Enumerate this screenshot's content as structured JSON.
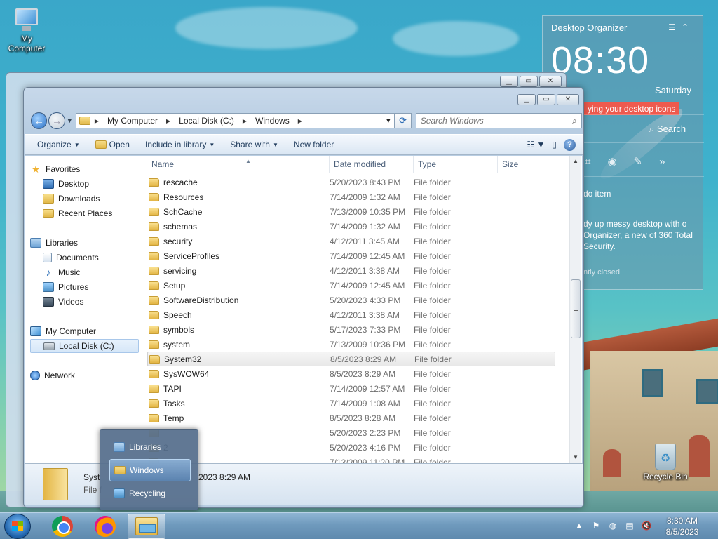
{
  "desktop": {
    "icons": [
      {
        "label": "My Computer"
      },
      {
        "label": "Recycle Bin"
      }
    ]
  },
  "organizer": {
    "title": "Desktop Organizer",
    "time": "08:30",
    "date_partial": "23",
    "weekday": "Saturday",
    "banner": "ying your desktop icons",
    "search_label": "Search",
    "todo": "do item",
    "description": "dy up messy desktop with o Organizer, a new of 360 Total Security.",
    "closed": "ntly closed"
  },
  "window": {
    "address": {
      "segments": [
        "My Computer",
        "Local Disk (C:)",
        "Windows"
      ]
    },
    "search": {
      "placeholder": "Search Windows"
    },
    "toolbar": {
      "organize": "Organize",
      "open": "Open",
      "include": "Include in library",
      "share": "Share with",
      "new_folder": "New folder"
    },
    "nav": {
      "favorites": "Favorites",
      "desktop": "Desktop",
      "downloads": "Downloads",
      "recent": "Recent Places",
      "libraries": "Libraries",
      "documents": "Documents",
      "music": "Music",
      "pictures": "Pictures",
      "videos": "Videos",
      "my_computer": "My Computer",
      "local_disk": "Local Disk (C:)",
      "network": "Network"
    },
    "columns": {
      "name": "Name",
      "date": "Date modified",
      "type": "Type",
      "size": "Size"
    },
    "files": [
      {
        "name": "rescache",
        "date": "5/20/2023 8:43 PM",
        "type": "File folder"
      },
      {
        "name": "Resources",
        "date": "7/14/2009 1:32 AM",
        "type": "File folder"
      },
      {
        "name": "SchCache",
        "date": "7/13/2009 10:35 PM",
        "type": "File folder"
      },
      {
        "name": "schemas",
        "date": "7/14/2009 1:32 AM",
        "type": "File folder"
      },
      {
        "name": "security",
        "date": "4/12/2011 3:45 AM",
        "type": "File folder"
      },
      {
        "name": "ServiceProfiles",
        "date": "7/14/2009 12:45 AM",
        "type": "File folder"
      },
      {
        "name": "servicing",
        "date": "4/12/2011 3:38 AM",
        "type": "File folder"
      },
      {
        "name": "Setup",
        "date": "7/14/2009 12:45 AM",
        "type": "File folder"
      },
      {
        "name": "SoftwareDistribution",
        "date": "5/20/2023 4:33 PM",
        "type": "File folder"
      },
      {
        "name": "Speech",
        "date": "4/12/2011 3:38 AM",
        "type": "File folder"
      },
      {
        "name": "symbols",
        "date": "5/17/2023 7:33 PM",
        "type": "File folder"
      },
      {
        "name": "system",
        "date": "7/13/2009 10:36 PM",
        "type": "File folder"
      },
      {
        "name": "System32",
        "date": "8/5/2023 8:29 AM",
        "type": "File folder"
      },
      {
        "name": "SysWOW64",
        "date": "8/5/2023 8:29 AM",
        "type": "File folder"
      },
      {
        "name": "TAPI",
        "date": "7/14/2009 12:57 AM",
        "type": "File folder"
      },
      {
        "name": "Tasks",
        "date": "7/14/2009 1:08 AM",
        "type": "File folder"
      },
      {
        "name": "Temp",
        "date": "8/5/2023 8:28 AM",
        "type": "File folder"
      },
      {
        "name": "",
        "date": "5/20/2023 2:23 PM",
        "type": "File folder"
      },
      {
        "name": "2",
        "date": "5/20/2023 4:16 PM",
        "type": "File folder"
      },
      {
        "name": "",
        "date": "7/13/2009 11:20 PM",
        "type": "File folder"
      }
    ],
    "details": {
      "name": "Syst",
      "type": "File f",
      "modified": "2023 8:29 AM"
    }
  },
  "jumplist": {
    "items": [
      {
        "label": "Libraries"
      },
      {
        "label": "Windows"
      },
      {
        "label": "Recycling"
      }
    ]
  },
  "taskbar": {
    "time": "8:30 AM",
    "date": "8/5/2023"
  }
}
